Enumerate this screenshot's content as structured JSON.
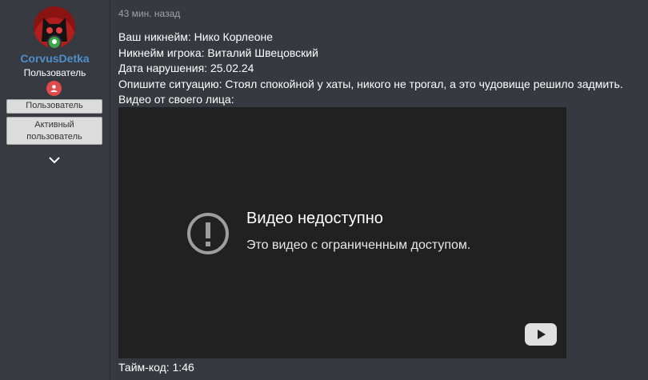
{
  "author": {
    "name": "CorvusDetka",
    "role": "Пользователь",
    "avatar_icon": "cat-avatar-icon",
    "online_color": "#3fa64a",
    "badges": [
      "Пользователь",
      "Активный пользователь"
    ],
    "expand_icon": "chevron-down-icon"
  },
  "post": {
    "time": "43 мин. назад",
    "lines": [
      "Ваш никнейм: Нико Корлеоне",
      "Никнейм игрока: Виталий Швецовский",
      "Дата нарушения: 25.02.24",
      "Опишите ситуацию: Стоял спокойной у хаты, никого не трогал, а это чудовище решило задмить.",
      "Видео от своего лица:"
    ],
    "video": {
      "title": "Видео недоступно",
      "message": "Это видео с ограниченным доступом.",
      "icon": "warning-icon",
      "logo_icon": "youtube-icon"
    },
    "timecode": "Тайм-код: 1:46"
  }
}
